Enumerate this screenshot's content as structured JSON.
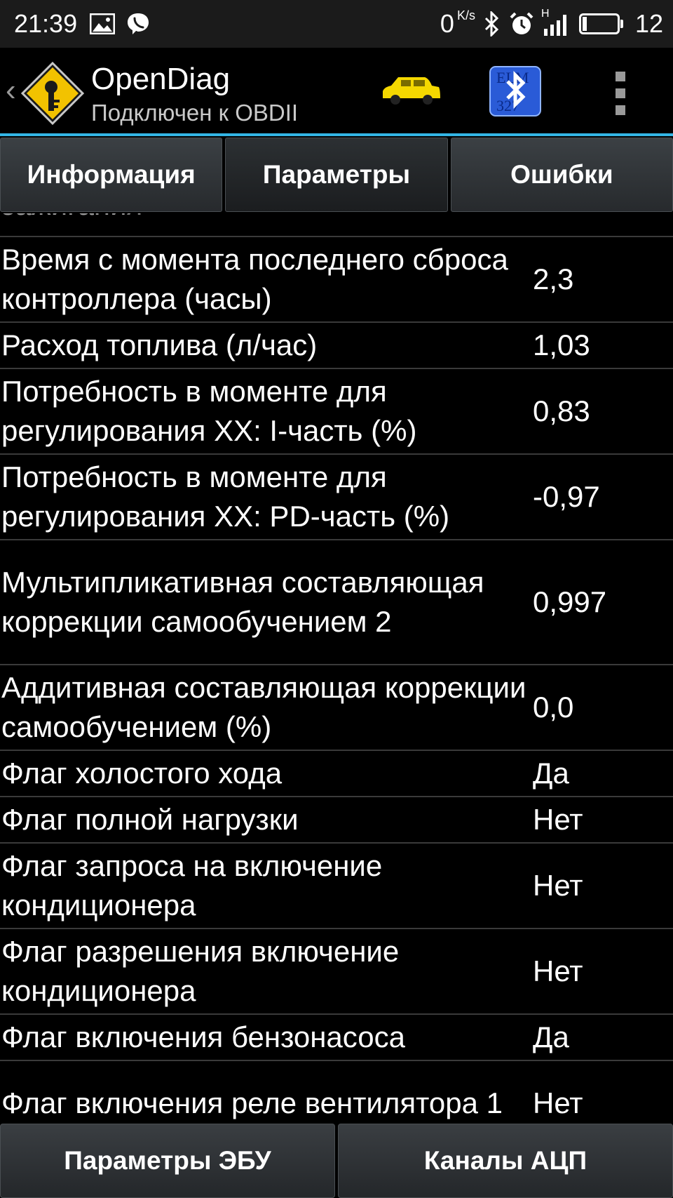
{
  "status_bar": {
    "time": "21:39",
    "net_speed": "0",
    "net_speed_unit": "K/s",
    "network_type": "H",
    "battery_level": "12",
    "icons": [
      "image-icon",
      "viber-icon",
      "bluetooth-icon",
      "alarm-icon",
      "signal-icon",
      "battery-icon"
    ]
  },
  "app_bar": {
    "title": "OpenDiag",
    "subtitle": "Подключен к OBDII",
    "icons": [
      "app-logo-icon",
      "car-icon",
      "bluetooth-elm327-icon",
      "overflow-menu-icon"
    ],
    "accent_color": "#33b5e5"
  },
  "tabs": [
    {
      "label": "Информация"
    },
    {
      "label": "Параметры"
    },
    {
      "label": "Ошибки"
    }
  ],
  "params": [
    {
      "name": "зажигания",
      "value": ""
    },
    {
      "name": "Время с момента последнего сброса контроллера (часы)",
      "value": "2,3"
    },
    {
      "name": "Расход топлива (л/час)",
      "value": "1,03"
    },
    {
      "name": "Потребность в моменте для регулирования XX: I-часть (%)",
      "value": "0,83"
    },
    {
      "name": "Потребность в моменте для регулирования XX: PD-часть (%)",
      "value": "-0,97"
    },
    {
      "name": "Мультипликативная составляющая коррекции самообучением 2",
      "value": "0,997"
    },
    {
      "name": "Аддитивная составляющая коррекции самообучением (%)",
      "value": "0,0"
    },
    {
      "name": "Флаг холостого хода",
      "value": "Да"
    },
    {
      "name": "Флаг полной нагрузки",
      "value": "Нет"
    },
    {
      "name": "Флаг запроса на включение кондиционера",
      "value": "Нет"
    },
    {
      "name": "Флаг разрешения включение кондиционера",
      "value": "Нет"
    },
    {
      "name": "Флаг включения бензонасоса",
      "value": "Да"
    },
    {
      "name": "Флаг включения реле вентилятора 1",
      "value": "Нет"
    }
  ],
  "bottom_buttons": [
    {
      "label": "Параметры ЭБУ"
    },
    {
      "label": "Каналы АЦП"
    }
  ]
}
